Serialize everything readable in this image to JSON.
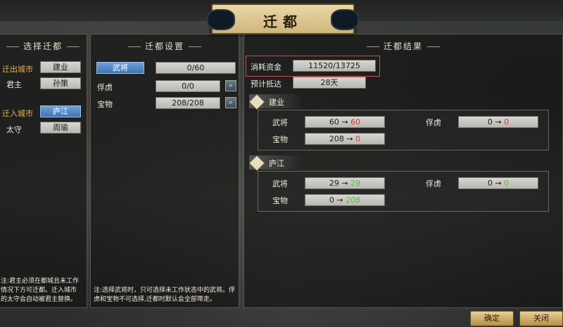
{
  "title": "迁都",
  "left": {
    "header": "选择迁都",
    "from_label": "迁出城市",
    "from_value": "建业",
    "lord_label": "君主",
    "lord_value": "孙策",
    "to_label": "迁入城市",
    "to_value": "庐江",
    "gov_label": "太守",
    "gov_value": "周瑜",
    "note": "注:君主必须在都城且未工作情况下方可迁都。迁入城市的太守会自动被君主替换。"
  },
  "middle": {
    "header": "迁都设置",
    "generals_label": "武将",
    "generals_value": "0/60",
    "captives_label": "俘虏",
    "captives_value": "0/0",
    "treasure_label": "宝物",
    "treasure_value": "208/208",
    "note": "注:选择武将时，只可选择未工作状态中的武将。俘虏和宝物不可选择,迁都时默认会全部带走。"
  },
  "right": {
    "header": "迁都结果",
    "cost_label": "消耗资金",
    "cost_value": "11520/13725",
    "eta_label": "预计抵达",
    "eta_value": "28天",
    "from_city": {
      "name": "建业",
      "generals_label": "武将",
      "generals_from": "60",
      "generals_to": "60",
      "captives_label": "俘虏",
      "captives_from": "0",
      "captives_to": "0",
      "treasure_label": "宝物",
      "treasure_from": "208",
      "treasure_to": "0"
    },
    "to_city": {
      "name": "庐江",
      "generals_label": "武将",
      "generals_from": "29",
      "generals_to": "29",
      "captives_label": "俘虏",
      "captives_from": "0",
      "captives_to": "0",
      "treasure_label": "宝物",
      "treasure_from": "0",
      "treasure_to": "208"
    },
    "arrow": "→"
  },
  "buttons": {
    "confirm": "确定",
    "close": "关闭"
  },
  "colors": {
    "negative": "#e03a2e",
    "positive": "#4ec23b",
    "highlight_border": "#d24b4b"
  }
}
